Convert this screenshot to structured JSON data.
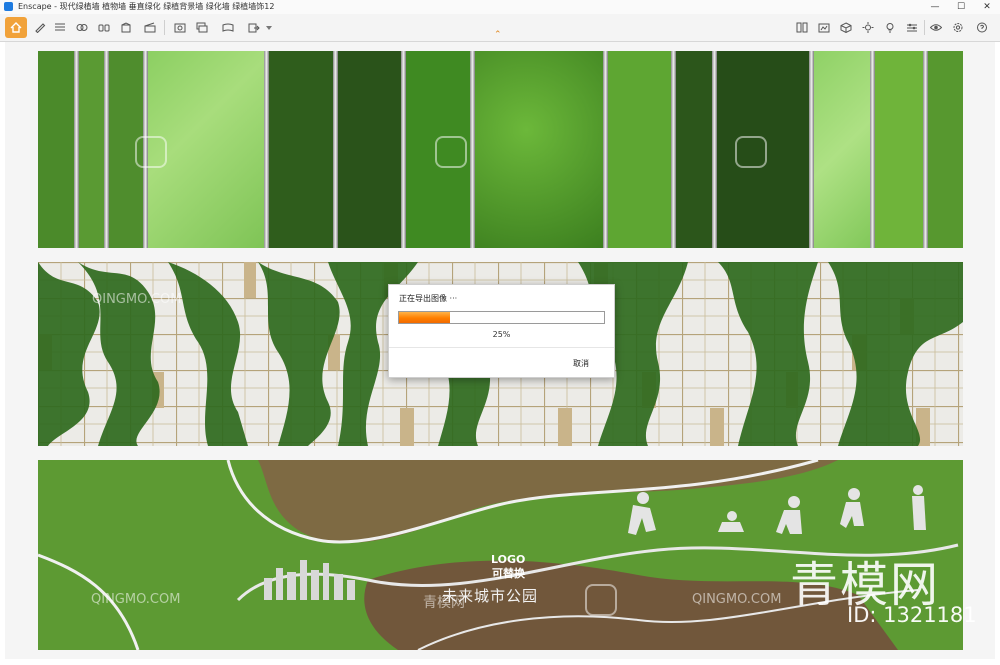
{
  "window": {
    "title": "Enscape - 现代绿植墙 植物墙 垂直绿化 绿植背景墙 绿化墙 绿植墙饰12",
    "minimize": "—",
    "maximize": "☐",
    "close": "✕"
  },
  "toolbar": {
    "left_icons": [
      "home-icon",
      "pen-icon",
      "bim-icon",
      "visual-settings-icon",
      "binoculars-icon",
      "object-icon",
      "clapperboard-icon",
      "screenshot-icon",
      "batch-render-icon",
      "panorama-icon",
      "export-icon"
    ],
    "right_icons": [
      "material-library-icon",
      "asset-library-icon",
      "cube-icon",
      "sun-icon",
      "light-icon",
      "presets-icon",
      "eye-icon",
      "settings-icon",
      "help-icon"
    ],
    "accent": "#f1a23a"
  },
  "export_dialog": {
    "title": "正在导出图像 ···",
    "progress": 0.25,
    "percent_text": "25%",
    "cancel_label": "取消",
    "progress_color": "#ff7f00"
  },
  "render": {
    "park_logo": "LOGO",
    "park_logo_sub": "可替换",
    "park_name": "未来城市公园"
  },
  "watermark": {
    "brand_cn": "青模网",
    "brand_en": "QINGMO.COM",
    "id_text": "ID: 1321181"
  }
}
